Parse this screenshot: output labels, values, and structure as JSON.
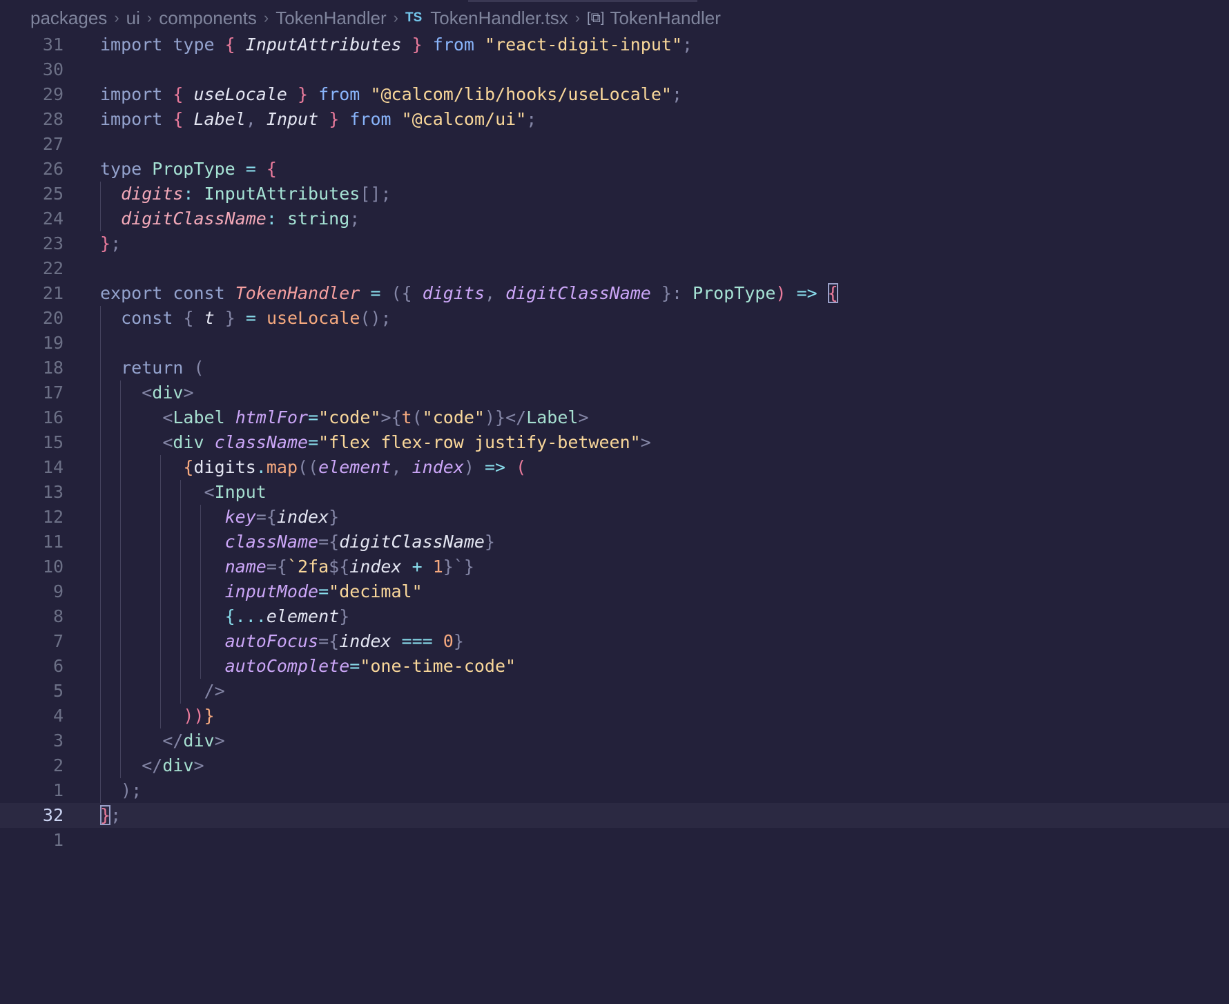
{
  "breadcrumb": {
    "items": [
      "packages",
      "ui",
      "components",
      "TokenHandler"
    ],
    "file_badge": "TS",
    "file_name": "TokenHandler.tsx",
    "symbol_name": "TokenHandler"
  },
  "lines": [
    {
      "n": "31"
    },
    {
      "n": "30"
    },
    {
      "n": "29"
    },
    {
      "n": "28"
    },
    {
      "n": "27"
    },
    {
      "n": "26"
    },
    {
      "n": "25"
    },
    {
      "n": "24"
    },
    {
      "n": "23"
    },
    {
      "n": "22"
    },
    {
      "n": "21"
    },
    {
      "n": "20"
    },
    {
      "n": "19"
    },
    {
      "n": "18"
    },
    {
      "n": "17"
    },
    {
      "n": "16"
    },
    {
      "n": "15"
    },
    {
      "n": "14"
    },
    {
      "n": "13"
    },
    {
      "n": "12"
    },
    {
      "n": "11"
    },
    {
      "n": "10"
    },
    {
      "n": "9"
    },
    {
      "n": "8"
    },
    {
      "n": "7"
    },
    {
      "n": "6"
    },
    {
      "n": "5"
    },
    {
      "n": "4"
    },
    {
      "n": "3"
    },
    {
      "n": "2"
    },
    {
      "n": "1"
    },
    {
      "n": "32"
    },
    {
      "n": "1"
    }
  ],
  "code": {
    "l0": [
      "import",
      "type",
      "{",
      "InputAttributes",
      "}",
      "from",
      "\"react-digit-input\"",
      ";"
    ],
    "l2": [
      "import",
      "{",
      "useLocale",
      "}",
      "from",
      "\"@calcom/lib/hooks/useLocale\"",
      ";"
    ],
    "l3": [
      "import",
      "{",
      "Label",
      ",",
      "Input",
      "}",
      "from",
      "\"@calcom/ui\"",
      ";"
    ],
    "l5": [
      "type",
      "PropType",
      "=",
      "{"
    ],
    "l6": [
      "digits",
      ":",
      "InputAttributes",
      "[]",
      ";"
    ],
    "l7": [
      "digitClassName",
      ":",
      "string",
      ";"
    ],
    "l8": [
      "}",
      ";"
    ],
    "l10": [
      "export",
      "const",
      "TokenHandler",
      "=",
      "({",
      "digits",
      ",",
      "digitClassName",
      "}:",
      "PropType",
      ")",
      "=>",
      "{"
    ],
    "l11": [
      "const",
      "{",
      "t",
      "}",
      "=",
      "useLocale",
      "()",
      ";"
    ],
    "l13": [
      "return",
      "("
    ],
    "l14": [
      "<",
      "div",
      ">"
    ],
    "l15": [
      "<",
      "Label",
      "htmlFor",
      "=",
      "\"code\"",
      ">{",
      "t",
      "(",
      "\"code\"",
      ")}",
      "</",
      "Label",
      ">"
    ],
    "l16": [
      "<",
      "div",
      "className",
      "=",
      "\"flex flex-row justify-between\"",
      ">"
    ],
    "l17": [
      "{",
      "digits",
      ".",
      "map",
      "((",
      "element",
      ",",
      "index",
      ")",
      "=>",
      "("
    ],
    "l18": [
      "<",
      "Input"
    ],
    "l19": [
      "key",
      "={",
      "index",
      "}"
    ],
    "l20": [
      "className",
      "={",
      "digitClassName",
      "}"
    ],
    "l21": [
      "name",
      "={",
      "`2fa",
      "${",
      "index",
      "+",
      "1",
      "}`",
      "}"
    ],
    "l22": [
      "inputMode",
      "=",
      "\"decimal\""
    ],
    "l23": [
      "{...",
      "element",
      "}"
    ],
    "l24": [
      "autoFocus",
      "={",
      "index",
      "===",
      "0",
      "}"
    ],
    "l25": [
      "autoComplete",
      "=",
      "\"one-time-code\""
    ],
    "l26": [
      "/>"
    ],
    "l27": [
      "))",
      "}"
    ],
    "l28": [
      "</",
      "div",
      ">"
    ],
    "l29": [
      "</",
      "div",
      ">"
    ],
    "l30": [
      ")",
      ";"
    ],
    "l31": [
      "}",
      ";"
    ]
  }
}
